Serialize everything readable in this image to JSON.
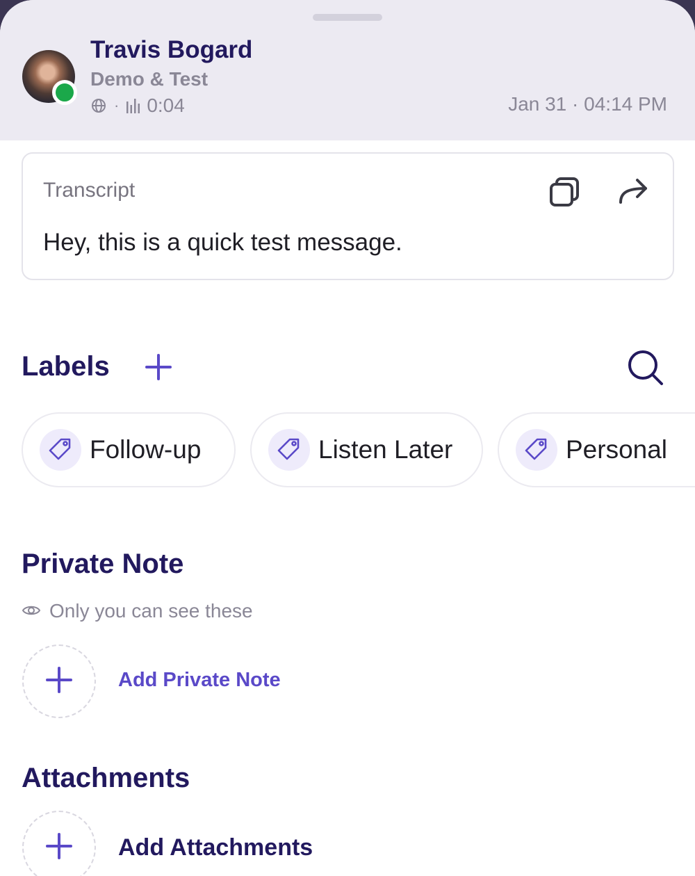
{
  "header": {
    "name": "Travis Bogard",
    "subtitle": "Demo & Test",
    "meta_separator": "·",
    "duration": "0:04",
    "datetime": "Jan 31 · 04:14 PM",
    "presence_color": "#1ba84a"
  },
  "transcript": {
    "label": "Transcript",
    "text": "Hey, this is a quick test message."
  },
  "labels": {
    "title": "Labels",
    "items": [
      {
        "label": "Follow-up"
      },
      {
        "label": "Listen Later"
      },
      {
        "label": "Personal"
      }
    ]
  },
  "private_note": {
    "title": "Private Note",
    "visibility_text": "Only you can see these",
    "add_label": "Add Private Note"
  },
  "attachments": {
    "title": "Attachments",
    "add_label": "Add Attachments"
  },
  "colors": {
    "accent": "#5a49c8",
    "heading": "#22195e",
    "muted": "#8a8796"
  }
}
